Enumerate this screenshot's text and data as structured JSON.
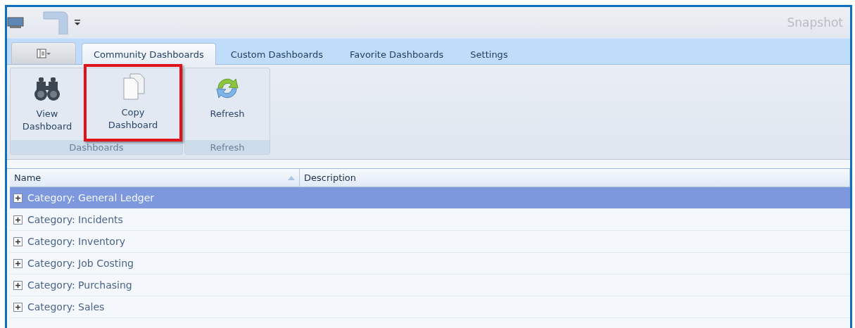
{
  "window": {
    "title": "Snapshot"
  },
  "tabs": [
    {
      "label": "Community Dashboards",
      "selected": true
    },
    {
      "label": "Custom Dashboards",
      "selected": false
    },
    {
      "label": "Favorite Dashboards",
      "selected": false
    },
    {
      "label": "Settings",
      "selected": false
    }
  ],
  "ribbon_groups": [
    {
      "label": "Dashboards",
      "buttons": [
        {
          "label": "View Dashboard",
          "kind": "binoculars",
          "highlighted": false
        },
        {
          "label": "Copy Dashboard",
          "kind": "copy",
          "highlighted": true
        }
      ]
    },
    {
      "label": "Refresh",
      "buttons": [
        {
          "label": "Refresh",
          "kind": "refresh",
          "highlighted": false
        }
      ]
    }
  ],
  "table": {
    "columns": [
      "Name",
      "Description"
    ],
    "rows": [
      {
        "name": "Category: General Ledger",
        "selected": true,
        "expanded": false
      },
      {
        "name": "Category: Incidents",
        "selected": false,
        "expanded": false
      },
      {
        "name": "Category: Inventory",
        "selected": false,
        "expanded": false
      },
      {
        "name": "Category: Job Costing",
        "selected": false,
        "expanded": false
      },
      {
        "name": "Category: Purchasing",
        "selected": false,
        "expanded": false
      },
      {
        "name": "Category: Sales",
        "selected": false,
        "expanded": false
      }
    ]
  }
}
